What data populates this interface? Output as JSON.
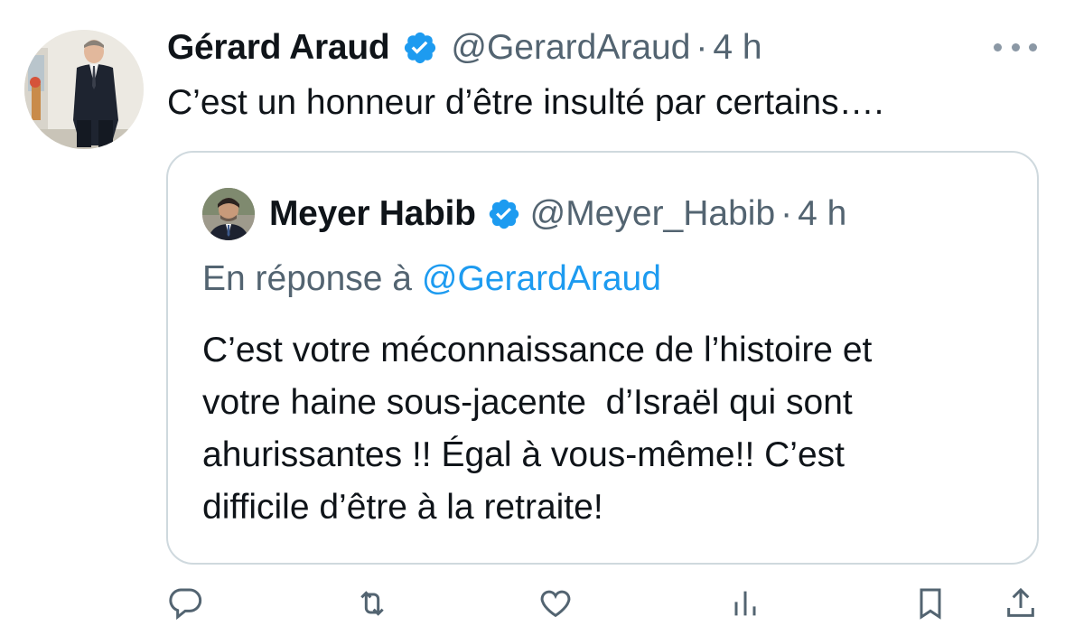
{
  "tweet": {
    "display_name": "Gérard Araud",
    "handle": "@GerardAraud",
    "separator": "·",
    "time": "4 h",
    "text": "C’est un honneur d’être insulté par certains…."
  },
  "quote": {
    "display_name": "Meyer Habib",
    "handle": "@Meyer_Habib",
    "separator": "·",
    "time": "4 h",
    "reply_prefix": "En réponse à",
    "reply_to": "@GerardAraud",
    "text_lines": [
      "C’est votre méconnaissance de l’histoire et",
      "votre haine sous-jacente  d’Israël qui sont",
      "ahurissantes !! Égal à vous-même!! C’est",
      "difficile d’être à la retraite!"
    ]
  },
  "icons": {
    "verified": "verified-badge-icon",
    "more": "more-horizontal-icon",
    "reply": "reply-icon",
    "retweet": "retweet-icon",
    "like": "like-icon",
    "views": "views-icon",
    "bookmark": "bookmark-icon",
    "share": "share-icon"
  },
  "colors": {
    "verified_blue": "#1d9bf0",
    "secondary_text": "#536471",
    "link": "#1d9bf0",
    "border": "#cfd9de"
  }
}
